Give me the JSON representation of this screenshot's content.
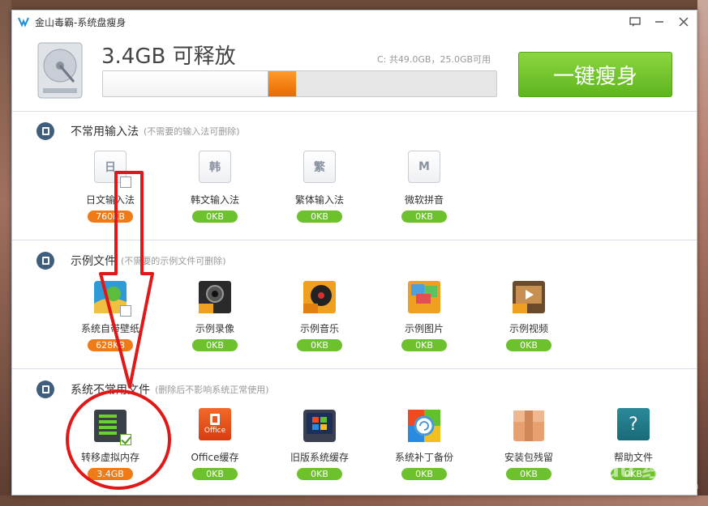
{
  "window": {
    "title": "金山毒霸-系统盘瘦身"
  },
  "header": {
    "free_text": "3.4GB 可释放",
    "disk_info": "C: 共49.0GB，25.0GB可用",
    "used_fraction": 0.42,
    "free_fraction": 0.07,
    "action_button": "一键瘦身"
  },
  "sections": [
    {
      "title": "不常用输入法",
      "subtitle": "(不需要的输入法可删除)",
      "items": [
        {
          "label": "日文输入法",
          "size": "760KB",
          "glyph": "日",
          "badge": "orange",
          "checked": false
        },
        {
          "label": "韩文输入法",
          "size": "0KB",
          "glyph": "韩",
          "badge": "green"
        },
        {
          "label": "繁体输入法",
          "size": "0KB",
          "glyph": "繁",
          "badge": "green"
        },
        {
          "label": "微软拼音",
          "size": "0KB",
          "glyph": "M",
          "badge": "green"
        }
      ]
    },
    {
      "title": "示例文件",
      "subtitle": "(不需要的示例文件可删除)",
      "items": [
        {
          "label": "系统自带壁纸",
          "size": "628KB",
          "icon": "wallpaper-icon",
          "badge": "orange",
          "checked": false
        },
        {
          "label": "示例录像",
          "size": "0KB",
          "icon": "video-recording-icon",
          "badge": "green"
        },
        {
          "label": "示例音乐",
          "size": "0KB",
          "icon": "music-icon",
          "badge": "green"
        },
        {
          "label": "示例图片",
          "size": "0KB",
          "icon": "pictures-icon",
          "badge": "green"
        },
        {
          "label": "示例视频",
          "size": "0KB",
          "icon": "video-icon",
          "badge": "green"
        }
      ]
    },
    {
      "title": "系统不常用文件",
      "subtitle": "(删除后不影响系统正常使用)",
      "items": [
        {
          "label": "转移虚拟内存",
          "size": "3.4GB",
          "icon": "memory-icon",
          "badge": "orange",
          "checked": true
        },
        {
          "label": "Office缓存",
          "size": "0KB",
          "icon": "office-icon",
          "office_text": "Office",
          "badge": "green"
        },
        {
          "label": "旧版系统缓存",
          "size": "0KB",
          "icon": "windows-icon",
          "badge": "green"
        },
        {
          "label": "系统补丁备份",
          "size": "0KB",
          "icon": "patch-backup-icon",
          "badge": "green"
        },
        {
          "label": "安装包残留",
          "size": "0KB",
          "icon": "package-icon",
          "badge": "green"
        },
        {
          "label": "帮助文件",
          "size": "0KB",
          "icon": "help-icon",
          "help_glyph": "?",
          "badge": "green"
        }
      ]
    }
  ],
  "watermark": {
    "brand": "Bai du 经验",
    "url": "jingyan.baidu.com"
  },
  "colors": {
    "green": "#6cc12c",
    "orange": "#f07a16",
    "section_icon": "#3f5d7c"
  }
}
